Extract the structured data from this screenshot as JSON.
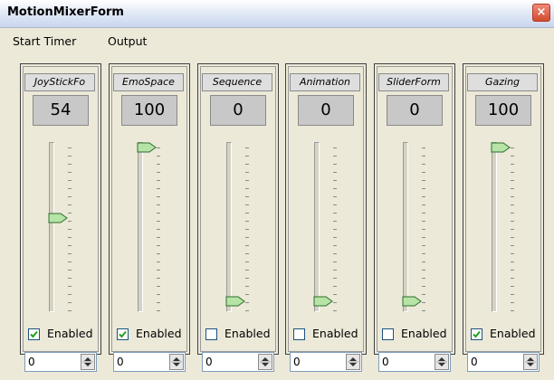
{
  "window": {
    "title": "MotionMixerForm",
    "close_glyph": "×"
  },
  "menu": [
    {
      "label": "Start Timer"
    },
    {
      "label": "Output"
    }
  ],
  "panels": [
    {
      "name": "JoyStickFo",
      "value": "54",
      "slider_fraction": 0.54,
      "enabled": true,
      "enabled_label": "Enabled",
      "spin_value": "0"
    },
    {
      "name": "EmoSpace",
      "value": "100",
      "slider_fraction": 1.0,
      "enabled": true,
      "enabled_label": "Enabled",
      "spin_value": "0"
    },
    {
      "name": "Sequence",
      "value": "0",
      "slider_fraction": 0.0,
      "enabled": false,
      "enabled_label": "Enabled",
      "spin_value": "0"
    },
    {
      "name": "Animation",
      "value": "0",
      "slider_fraction": 0.0,
      "enabled": false,
      "enabled_label": "Enabled",
      "spin_value": "0"
    },
    {
      "name": "SliderForm",
      "value": "0",
      "slider_fraction": 0.0,
      "enabled": false,
      "enabled_label": "Enabled",
      "spin_value": "0"
    },
    {
      "name": "Gazing",
      "value": "100",
      "slider_fraction": 1.0,
      "enabled": true,
      "enabled_label": "Enabled",
      "spin_value": "0"
    }
  ],
  "colors": {
    "thumb_fill": "#b6e3a6",
    "thumb_stroke": "#2e6e2e",
    "check_color": "#21a121"
  }
}
